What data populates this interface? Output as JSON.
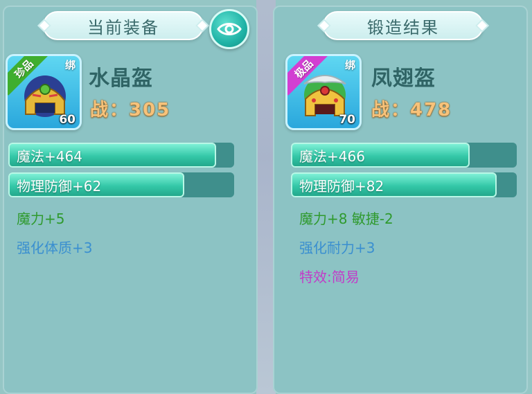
{
  "colors": {
    "panel_bg": "#8cc3c4",
    "grade_green": "#3fae2f",
    "grade_purple": "#d23fd2",
    "attr_green": "#2f9a2e",
    "attr_blue": "#3a8fd0",
    "attr_purple": "#c23cc8",
    "power_gold": "#f7c27a"
  },
  "left_panel": {
    "title": "当前装备",
    "eye_icon": "eye-icon",
    "item": {
      "name": "水晶盔",
      "grade": "珍品",
      "bind": "绑",
      "level": "60",
      "power": "战：305",
      "icon": "helmet-icon"
    },
    "stats": [
      {
        "label": "魔法+464",
        "fill": 0.92
      },
      {
        "label": "物理防御+62",
        "fill": 0.78
      }
    ],
    "attrs": [
      {
        "text": "魔力+5",
        "color": "green"
      },
      {
        "text": "强化体质+3",
        "color": "blue"
      }
    ]
  },
  "right_panel": {
    "title": "锻造结果",
    "item": {
      "name": "凤翅盔",
      "grade": "极品",
      "bind": "绑",
      "level": "70",
      "power": "战：478",
      "icon": "helmet-icon"
    },
    "stats": [
      {
        "label": "魔法+466",
        "fill": 0.79
      },
      {
        "label": "物理防御+82",
        "fill": 0.91
      }
    ],
    "attrs": [
      {
        "text": "魔力+8 敏捷-2",
        "color": "green"
      },
      {
        "text": "强化耐力+3",
        "color": "blue"
      },
      {
        "text": "特效:简易",
        "color": "purple"
      }
    ]
  }
}
